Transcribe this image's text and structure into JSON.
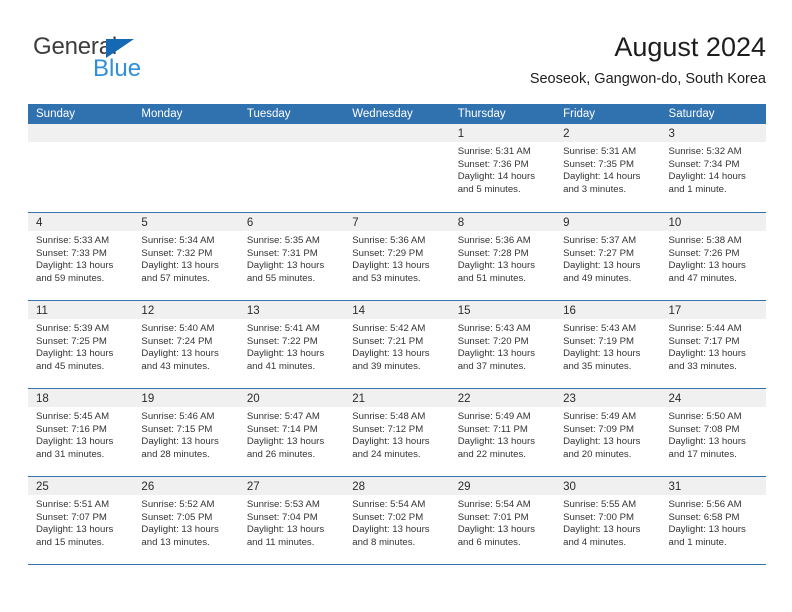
{
  "brand": {
    "name_part1": "General",
    "name_part2": "Blue",
    "triangle_color": "#1568b4",
    "blue_text_color": "#2f8fd8"
  },
  "header": {
    "title": "August 2024",
    "subtitle": "Seoseok, Gangwon-do, South Korea"
  },
  "theme": {
    "header_blue": "#3071b0",
    "numband_gray": "#f0f0f0",
    "text_color": "#343434"
  },
  "weekday_headers": [
    "Sunday",
    "Monday",
    "Tuesday",
    "Wednesday",
    "Thursday",
    "Friday",
    "Saturday"
  ],
  "weeks": [
    [
      {
        "day": "",
        "empty": true
      },
      {
        "day": "",
        "empty": true
      },
      {
        "day": "",
        "empty": true
      },
      {
        "day": "",
        "empty": true
      },
      {
        "day": "1",
        "sunrise": "Sunrise: 5:31 AM",
        "sunset": "Sunset: 7:36 PM",
        "daylight1": "Daylight: 14 hours",
        "daylight2": "and 5 minutes."
      },
      {
        "day": "2",
        "sunrise": "Sunrise: 5:31 AM",
        "sunset": "Sunset: 7:35 PM",
        "daylight1": "Daylight: 14 hours",
        "daylight2": "and 3 minutes."
      },
      {
        "day": "3",
        "sunrise": "Sunrise: 5:32 AM",
        "sunset": "Sunset: 7:34 PM",
        "daylight1": "Daylight: 14 hours",
        "daylight2": "and 1 minute."
      }
    ],
    [
      {
        "day": "4",
        "sunrise": "Sunrise: 5:33 AM",
        "sunset": "Sunset: 7:33 PM",
        "daylight1": "Daylight: 13 hours",
        "daylight2": "and 59 minutes."
      },
      {
        "day": "5",
        "sunrise": "Sunrise: 5:34 AM",
        "sunset": "Sunset: 7:32 PM",
        "daylight1": "Daylight: 13 hours",
        "daylight2": "and 57 minutes."
      },
      {
        "day": "6",
        "sunrise": "Sunrise: 5:35 AM",
        "sunset": "Sunset: 7:31 PM",
        "daylight1": "Daylight: 13 hours",
        "daylight2": "and 55 minutes."
      },
      {
        "day": "7",
        "sunrise": "Sunrise: 5:36 AM",
        "sunset": "Sunset: 7:29 PM",
        "daylight1": "Daylight: 13 hours",
        "daylight2": "and 53 minutes."
      },
      {
        "day": "8",
        "sunrise": "Sunrise: 5:36 AM",
        "sunset": "Sunset: 7:28 PM",
        "daylight1": "Daylight: 13 hours",
        "daylight2": "and 51 minutes."
      },
      {
        "day": "9",
        "sunrise": "Sunrise: 5:37 AM",
        "sunset": "Sunset: 7:27 PM",
        "daylight1": "Daylight: 13 hours",
        "daylight2": "and 49 minutes."
      },
      {
        "day": "10",
        "sunrise": "Sunrise: 5:38 AM",
        "sunset": "Sunset: 7:26 PM",
        "daylight1": "Daylight: 13 hours",
        "daylight2": "and 47 minutes."
      }
    ],
    [
      {
        "day": "11",
        "sunrise": "Sunrise: 5:39 AM",
        "sunset": "Sunset: 7:25 PM",
        "daylight1": "Daylight: 13 hours",
        "daylight2": "and 45 minutes."
      },
      {
        "day": "12",
        "sunrise": "Sunrise: 5:40 AM",
        "sunset": "Sunset: 7:24 PM",
        "daylight1": "Daylight: 13 hours",
        "daylight2": "and 43 minutes."
      },
      {
        "day": "13",
        "sunrise": "Sunrise: 5:41 AM",
        "sunset": "Sunset: 7:22 PM",
        "daylight1": "Daylight: 13 hours",
        "daylight2": "and 41 minutes."
      },
      {
        "day": "14",
        "sunrise": "Sunrise: 5:42 AM",
        "sunset": "Sunset: 7:21 PM",
        "daylight1": "Daylight: 13 hours",
        "daylight2": "and 39 minutes."
      },
      {
        "day": "15",
        "sunrise": "Sunrise: 5:43 AM",
        "sunset": "Sunset: 7:20 PM",
        "daylight1": "Daylight: 13 hours",
        "daylight2": "and 37 minutes."
      },
      {
        "day": "16",
        "sunrise": "Sunrise: 5:43 AM",
        "sunset": "Sunset: 7:19 PM",
        "daylight1": "Daylight: 13 hours",
        "daylight2": "and 35 minutes."
      },
      {
        "day": "17",
        "sunrise": "Sunrise: 5:44 AM",
        "sunset": "Sunset: 7:17 PM",
        "daylight1": "Daylight: 13 hours",
        "daylight2": "and 33 minutes."
      }
    ],
    [
      {
        "day": "18",
        "sunrise": "Sunrise: 5:45 AM",
        "sunset": "Sunset: 7:16 PM",
        "daylight1": "Daylight: 13 hours",
        "daylight2": "and 31 minutes."
      },
      {
        "day": "19",
        "sunrise": "Sunrise: 5:46 AM",
        "sunset": "Sunset: 7:15 PM",
        "daylight1": "Daylight: 13 hours",
        "daylight2": "and 28 minutes."
      },
      {
        "day": "20",
        "sunrise": "Sunrise: 5:47 AM",
        "sunset": "Sunset: 7:14 PM",
        "daylight1": "Daylight: 13 hours",
        "daylight2": "and 26 minutes."
      },
      {
        "day": "21",
        "sunrise": "Sunrise: 5:48 AM",
        "sunset": "Sunset: 7:12 PM",
        "daylight1": "Daylight: 13 hours",
        "daylight2": "and 24 minutes."
      },
      {
        "day": "22",
        "sunrise": "Sunrise: 5:49 AM",
        "sunset": "Sunset: 7:11 PM",
        "daylight1": "Daylight: 13 hours",
        "daylight2": "and 22 minutes."
      },
      {
        "day": "23",
        "sunrise": "Sunrise: 5:49 AM",
        "sunset": "Sunset: 7:09 PM",
        "daylight1": "Daylight: 13 hours",
        "daylight2": "and 20 minutes."
      },
      {
        "day": "24",
        "sunrise": "Sunrise: 5:50 AM",
        "sunset": "Sunset: 7:08 PM",
        "daylight1": "Daylight: 13 hours",
        "daylight2": "and 17 minutes."
      }
    ],
    [
      {
        "day": "25",
        "sunrise": "Sunrise: 5:51 AM",
        "sunset": "Sunset: 7:07 PM",
        "daylight1": "Daylight: 13 hours",
        "daylight2": "and 15 minutes."
      },
      {
        "day": "26",
        "sunrise": "Sunrise: 5:52 AM",
        "sunset": "Sunset: 7:05 PM",
        "daylight1": "Daylight: 13 hours",
        "daylight2": "and 13 minutes."
      },
      {
        "day": "27",
        "sunrise": "Sunrise: 5:53 AM",
        "sunset": "Sunset: 7:04 PM",
        "daylight1": "Daylight: 13 hours",
        "daylight2": "and 11 minutes."
      },
      {
        "day": "28",
        "sunrise": "Sunrise: 5:54 AM",
        "sunset": "Sunset: 7:02 PM",
        "daylight1": "Daylight: 13 hours",
        "daylight2": "and 8 minutes."
      },
      {
        "day": "29",
        "sunrise": "Sunrise: 5:54 AM",
        "sunset": "Sunset: 7:01 PM",
        "daylight1": "Daylight: 13 hours",
        "daylight2": "and 6 minutes."
      },
      {
        "day": "30",
        "sunrise": "Sunrise: 5:55 AM",
        "sunset": "Sunset: 7:00 PM",
        "daylight1": "Daylight: 13 hours",
        "daylight2": "and 4 minutes."
      },
      {
        "day": "31",
        "sunrise": "Sunrise: 5:56 AM",
        "sunset": "Sunset: 6:58 PM",
        "daylight1": "Daylight: 13 hours",
        "daylight2": "and 1 minute."
      }
    ]
  ]
}
